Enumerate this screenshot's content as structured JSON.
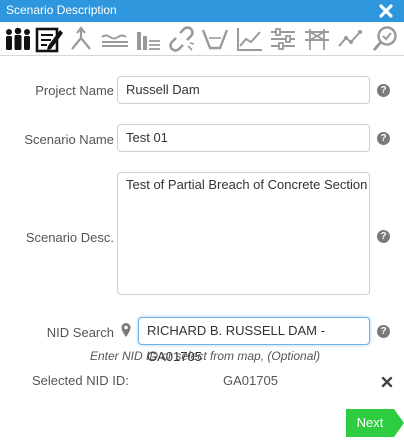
{
  "window": {
    "title": "Scenario Description"
  },
  "toolbar": {
    "tools": [
      {
        "name": "team-icon",
        "active": false
      },
      {
        "name": "scenario-edit-icon",
        "active": true
      },
      {
        "name": "breach-split-icon",
        "active": false
      },
      {
        "name": "water-surface-icon",
        "active": false
      },
      {
        "name": "level-bars-icon",
        "active": false
      },
      {
        "name": "broken-link-icon",
        "active": false
      },
      {
        "name": "channel-section-icon",
        "active": false
      },
      {
        "name": "line-chart-icon",
        "active": false
      },
      {
        "name": "sliders-icon",
        "active": false
      },
      {
        "name": "structure-icon",
        "active": false
      },
      {
        "name": "trend-icon",
        "active": false
      },
      {
        "name": "search-result-icon",
        "active": false
      }
    ]
  },
  "form": {
    "project_name": {
      "label": "Project Name",
      "value": "Russell Dam"
    },
    "scenario_name": {
      "label": "Scenario Name",
      "value": "Test 01"
    },
    "scenario_desc": {
      "label": "Scenario Desc.",
      "value": "Test of Partial Breach of Concrete Section"
    },
    "nid_search": {
      "label": "NID Search",
      "value": "RICHARD B. RUSSELL DAM - GA01705",
      "hint": "Enter NID ID or select from map, (Optional)"
    },
    "selected_nid": {
      "label": "Selected NID ID:",
      "value": "GA01705"
    },
    "help_glyph": "?"
  },
  "footer": {
    "next_label": "Next"
  },
  "colors": {
    "titlebar": "#2e96dc",
    "next_button": "#2ecc40",
    "focus_border": "#6fb3e8"
  }
}
